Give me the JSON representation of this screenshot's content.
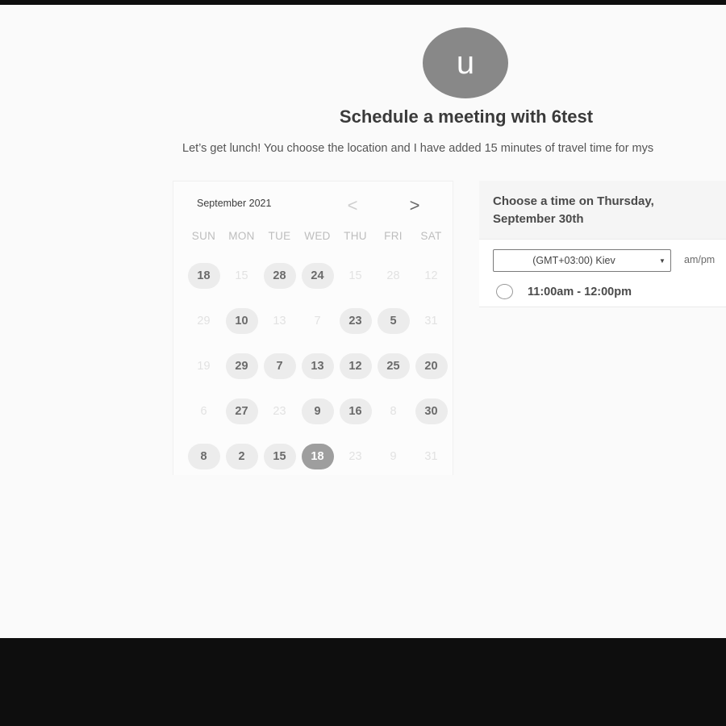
{
  "host": {
    "avatar_letter": "u",
    "title": "Schedule a meeting with 6test",
    "description": "Let’s get lunch! You choose the location and I have added 15 minutes of travel time for mys"
  },
  "calendar": {
    "month_label": "September 2021",
    "prev_icon": "chevron-left-icon",
    "next_icon": "chevron-right-icon",
    "prev_glyph": "<",
    "next_glyph": ">",
    "weekdays": [
      "SUN",
      "MON",
      "TUE",
      "WED",
      "THU",
      "FRI",
      "SAT"
    ],
    "weeks": [
      [
        {
          "label": "18",
          "state": "available"
        },
        {
          "label": "15",
          "state": "disabled"
        },
        {
          "label": "28",
          "state": "available"
        },
        {
          "label": "24",
          "state": "available"
        },
        {
          "label": "15",
          "state": "disabled"
        },
        {
          "label": "28",
          "state": "disabled"
        },
        {
          "label": "12",
          "state": "disabled"
        }
      ],
      [
        {
          "label": "29",
          "state": "disabled"
        },
        {
          "label": "10",
          "state": "available"
        },
        {
          "label": "13",
          "state": "disabled"
        },
        {
          "label": "7",
          "state": "disabled"
        },
        {
          "label": "23",
          "state": "available"
        },
        {
          "label": "5",
          "state": "available"
        },
        {
          "label": "31",
          "state": "disabled"
        }
      ],
      [
        {
          "label": "19",
          "state": "disabled"
        },
        {
          "label": "29",
          "state": "available"
        },
        {
          "label": "7",
          "state": "available"
        },
        {
          "label": "13",
          "state": "available"
        },
        {
          "label": "12",
          "state": "available"
        },
        {
          "label": "25",
          "state": "available"
        },
        {
          "label": "20",
          "state": "available"
        }
      ],
      [
        {
          "label": "6",
          "state": "disabled"
        },
        {
          "label": "27",
          "state": "available"
        },
        {
          "label": "23",
          "state": "disabled"
        },
        {
          "label": "9",
          "state": "available"
        },
        {
          "label": "16",
          "state": "available"
        },
        {
          "label": "8",
          "state": "disabled"
        },
        {
          "label": "30",
          "state": "available"
        }
      ],
      [
        {
          "label": "8",
          "state": "available"
        },
        {
          "label": "2",
          "state": "available"
        },
        {
          "label": "15",
          "state": "available"
        },
        {
          "label": "18",
          "state": "selected"
        },
        {
          "label": "23",
          "state": "disabled"
        },
        {
          "label": "9",
          "state": "disabled"
        },
        {
          "label": "31",
          "state": "disabled"
        }
      ]
    ]
  },
  "time_panel": {
    "heading": "Choose a time on Thursday, September 30th",
    "timezone": "(GMT+03:00) Kiev",
    "caret_glyph": "▼",
    "ampm_label": "am/pm",
    "slots": [
      {
        "label": "11:00am - 12:00pm",
        "selected": false
      }
    ]
  },
  "colors": {
    "page_background": "#fafafa",
    "frame": "#0e0e0e",
    "avatar": "#888888",
    "available_day": "#ececec",
    "selected_day": "#9e9e9e"
  }
}
